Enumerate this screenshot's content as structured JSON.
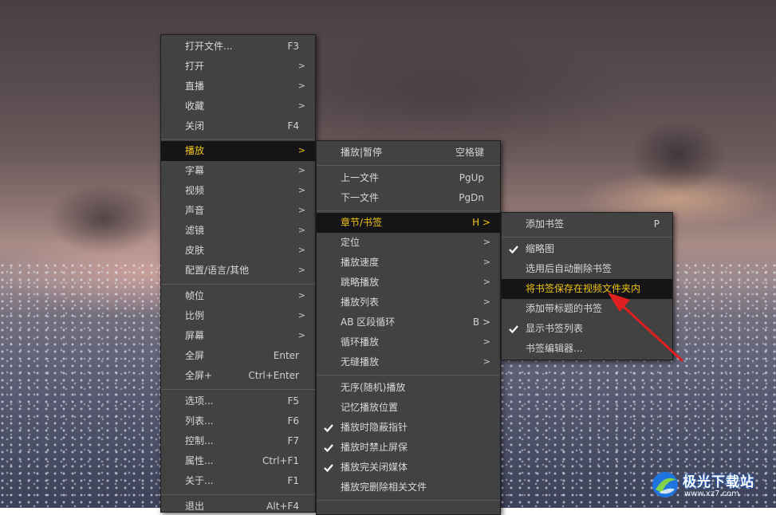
{
  "colors": {
    "menu_bg": "#424242",
    "highlight_bg": "#151515",
    "highlight_text": "#f1c40f",
    "text": "#d8d8d8",
    "annotation_arrow": "#e02020"
  },
  "main_menu": {
    "items": [
      {
        "label": "打开文件...",
        "shortcut": "F3",
        "submenu": false
      },
      {
        "label": "打开",
        "shortcut": "",
        "submenu": true
      },
      {
        "label": "直播",
        "shortcut": "",
        "submenu": true
      },
      {
        "label": "收藏",
        "shortcut": "",
        "submenu": true
      },
      {
        "label": "关闭",
        "shortcut": "F4",
        "submenu": false
      },
      {
        "label": "播放",
        "shortcut": "",
        "submenu": true,
        "highlighted": true
      },
      {
        "label": "字幕",
        "shortcut": "",
        "submenu": true
      },
      {
        "label": "视频",
        "shortcut": "",
        "submenu": true
      },
      {
        "label": "声音",
        "shortcut": "",
        "submenu": true
      },
      {
        "label": "滤镜",
        "shortcut": "",
        "submenu": true
      },
      {
        "label": "皮肤",
        "shortcut": "",
        "submenu": true
      },
      {
        "label": "配置/语言/其他",
        "shortcut": "",
        "submenu": true
      },
      {
        "label": "帧位",
        "shortcut": "",
        "submenu": true
      },
      {
        "label": "比例",
        "shortcut": "",
        "submenu": true
      },
      {
        "label": "屏幕",
        "shortcut": "",
        "submenu": true
      },
      {
        "label": "全屏",
        "shortcut": "Enter",
        "submenu": false
      },
      {
        "label": "全屏+",
        "shortcut": "Ctrl+Enter",
        "submenu": false
      },
      {
        "label": "选项...",
        "shortcut": "F5",
        "submenu": false
      },
      {
        "label": "列表...",
        "shortcut": "F6",
        "submenu": false
      },
      {
        "label": "控制...",
        "shortcut": "F7",
        "submenu": false
      },
      {
        "label": "属性...",
        "shortcut": "Ctrl+F1",
        "submenu": false
      },
      {
        "label": "关于...",
        "shortcut": "F1",
        "submenu": false
      },
      {
        "label": "退出",
        "shortcut": "Alt+F4",
        "submenu": false
      }
    ]
  },
  "play_menu": {
    "items": [
      {
        "label": "播放|暂停",
        "shortcut": "空格键",
        "submenu": false
      },
      {
        "label": "上一文件",
        "shortcut": "PgUp",
        "submenu": false
      },
      {
        "label": "下一文件",
        "shortcut": "PgDn",
        "submenu": false
      },
      {
        "label": "章节/书签",
        "shortcut": "H >",
        "submenu": false,
        "highlighted": true
      },
      {
        "label": "定位",
        "shortcut": "",
        "submenu": true
      },
      {
        "label": "播放速度",
        "shortcut": "",
        "submenu": true
      },
      {
        "label": "跳略播放",
        "shortcut": "",
        "submenu": true
      },
      {
        "label": "播放列表",
        "shortcut": "",
        "submenu": true
      },
      {
        "label": "AB 区段循环",
        "shortcut": "B >",
        "submenu": false
      },
      {
        "label": "循环播放",
        "shortcut": "",
        "submenu": true
      },
      {
        "label": "无缝播放",
        "shortcut": "",
        "submenu": true
      },
      {
        "label": "无序(随机)播放",
        "shortcut": "",
        "submenu": false
      },
      {
        "label": "记忆播放位置",
        "shortcut": "",
        "submenu": false
      },
      {
        "label": "播放时隐蔽指针",
        "shortcut": "",
        "submenu": false,
        "checked": true
      },
      {
        "label": "播放时禁止屏保",
        "shortcut": "",
        "submenu": false,
        "checked": true
      },
      {
        "label": "播放完关闭媒体",
        "shortcut": "",
        "submenu": false,
        "checked": true
      },
      {
        "label": "播放完删除相关文件",
        "shortcut": "",
        "submenu": false
      }
    ]
  },
  "bookmark_menu": {
    "items": [
      {
        "label": "添加书签",
        "shortcut": "P",
        "submenu": false
      },
      {
        "label": "缩略图",
        "shortcut": "",
        "checked": true
      },
      {
        "label": "选用后自动删除书签",
        "shortcut": ""
      },
      {
        "label": "将书签保存在视频文件夹内",
        "shortcut": "",
        "highlighted": true
      },
      {
        "label": "添加带标题的书签",
        "shortcut": ""
      },
      {
        "label": "显示书签列表",
        "shortcut": "",
        "checked": true
      },
      {
        "label": "书签编辑器...",
        "shortcut": ""
      }
    ]
  },
  "watermark": {
    "text": "极光下载站",
    "sub": "www.xz7.com"
  }
}
